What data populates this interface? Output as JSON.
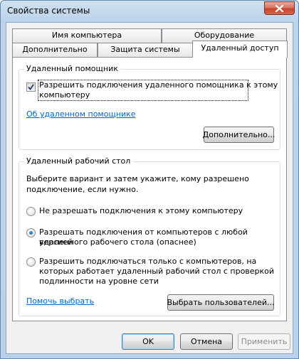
{
  "window": {
    "title": "Свойства системы",
    "close_icon": "close-x-icon"
  },
  "tabs": {
    "row_back": [
      "Имя компьютера",
      "Оборудование"
    ],
    "row_front": [
      "Дополнительно",
      "Защита системы",
      "Удаленный доступ"
    ],
    "selected": "Удаленный доступ"
  },
  "remote_assistance": {
    "title": "Удаленный помощник",
    "checkbox_label_line1": "Разрешить подключения удаленного помощника к этому",
    "checkbox_label_line2": "компьютеру",
    "checked": true,
    "about_link": "Об удаленном помощнике",
    "advanced_button": "Дополнительно..."
  },
  "remote_desktop": {
    "title": "Удаленный рабочий стол",
    "instruction_line1": "Выберите вариант и затем укажите, кому разрешено",
    "instruction_line2": "подключение, если нужно.",
    "options": [
      {
        "lines": [
          "Не разрешать подключения к этому компьютеру"
        ],
        "selected": false
      },
      {
        "lines": [
          "Разрешать подключения от компьютеров с любой версией",
          "удаленного рабочего стола (опаснее)"
        ],
        "selected": true
      },
      {
        "lines": [
          "Разрешить подключаться только с компьютеров, на",
          "которых работает удаленный рабочий стол с проверкой",
          "подлинности на уровне сети"
        ],
        "selected": false
      }
    ],
    "help_link": "Помочь выбрать",
    "select_users_button": "Выбрать пользователей..."
  },
  "footer": {
    "ok": "OK",
    "cancel": "Отмена",
    "apply": "Применить",
    "apply_enabled": false
  },
  "colors": {
    "link": "#0066cc",
    "radio_selected": "#0d4f8b",
    "close_button": "#c7442a"
  }
}
